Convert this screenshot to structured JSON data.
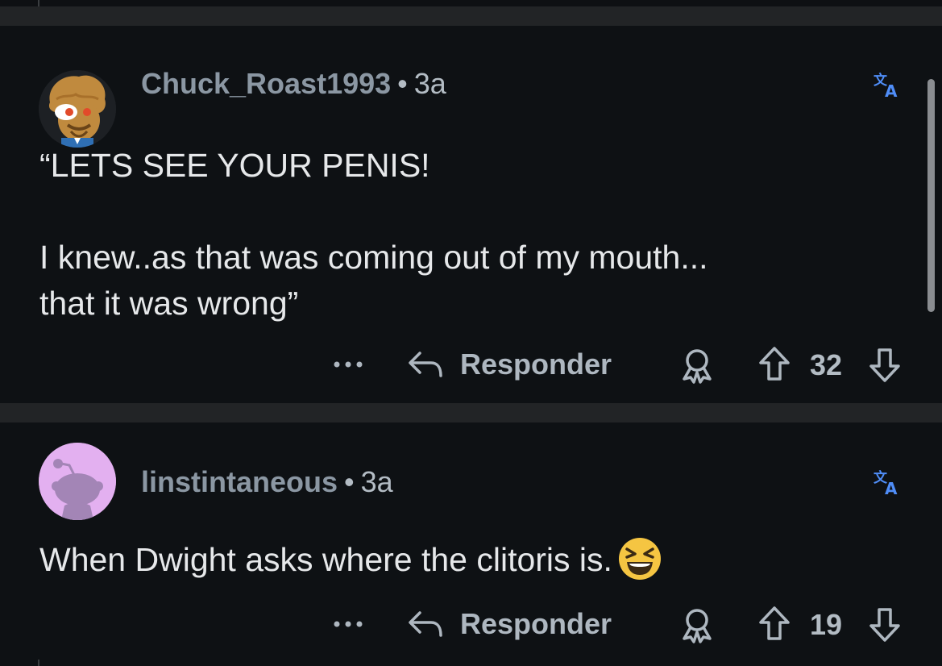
{
  "comments": [
    {
      "username": "Chuck_Roast1993",
      "separator": "•",
      "age": "3a",
      "body": "“LETS SEE YOUR PENIS!\n\nI knew..as that was coming out of my mouth...\nthat it was wrong”",
      "reply_label": "Responder",
      "score": "32",
      "avatar_icon": "cartoon-avatar-icon",
      "translate_icon": "translate-icon"
    },
    {
      "username": "linstintaneous",
      "separator": "•",
      "age": "3a",
      "body": "When Dwight asks where the clitoris is.",
      "emoji": "grinning-squinting-face-emoji",
      "reply_label": "Responder",
      "score": "19",
      "avatar_icon": "snoo-avatar-icon",
      "translate_icon": "translate-icon"
    }
  ],
  "colors": {
    "background": "#0e1114",
    "divider": "#222426",
    "username": "#8b97a3",
    "translate": "#4f8df7"
  }
}
